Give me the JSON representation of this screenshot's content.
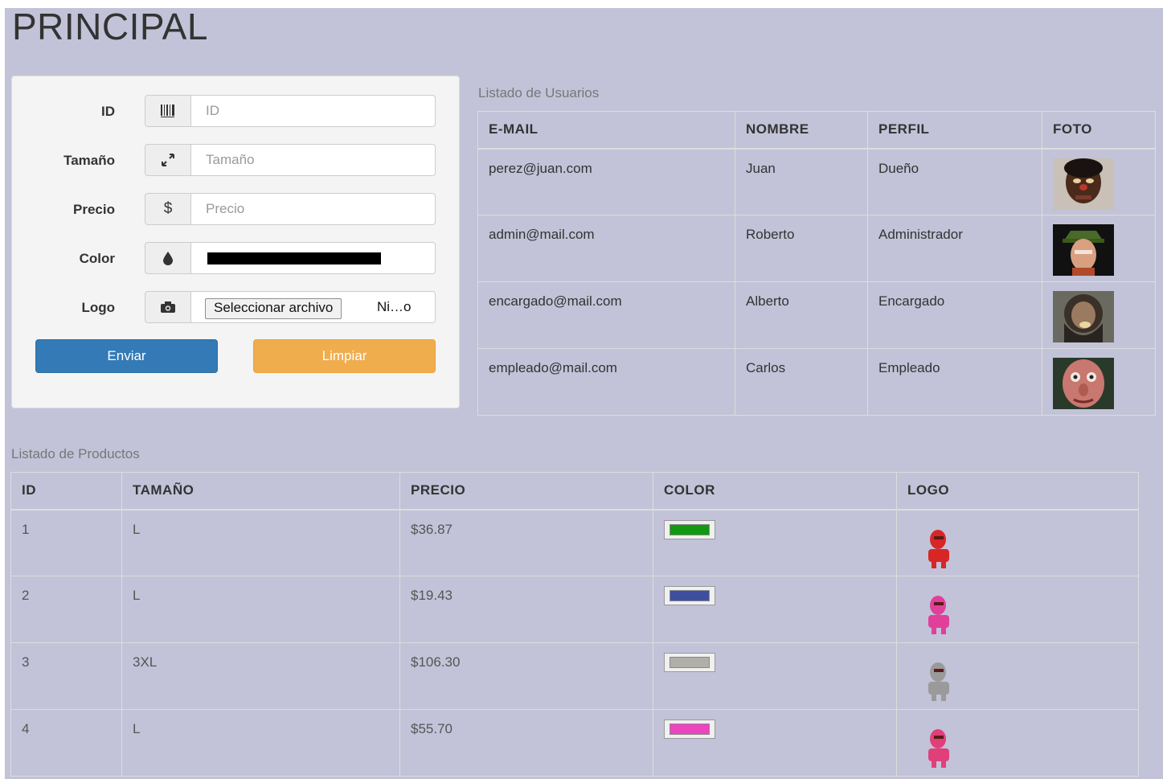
{
  "page_title": "PRINCIPAL",
  "form": {
    "fields": [
      {
        "label": "ID",
        "placeholder": "ID",
        "icon": "barcode-icon"
      },
      {
        "label": "Tamaño",
        "placeholder": "Tamaño",
        "icon": "resize-icon"
      },
      {
        "label": "Precio",
        "placeholder": "Precio",
        "icon": "dollar-icon"
      },
      {
        "label": "Color",
        "value": "#000000",
        "icon": "tint-icon"
      },
      {
        "label": "Logo",
        "file_button": "Seleccionar archivo",
        "file_name": "Ni…o",
        "icon": "camera-icon"
      }
    ],
    "submit_label": "Enviar",
    "clear_label": "Limpiar"
  },
  "users": {
    "caption": "Listado de Usuarios",
    "headers": [
      "E-MAIL",
      "NOMBRE",
      "PERFIL",
      "FOTO"
    ],
    "rows": [
      {
        "email": "perez@juan.com",
        "nombre": "Juan",
        "perfil": "Dueño"
      },
      {
        "email": "admin@mail.com",
        "nombre": "Roberto",
        "perfil": "Administrador"
      },
      {
        "email": "encargado@mail.com",
        "nombre": "Alberto",
        "perfil": "Encargado"
      },
      {
        "email": "empleado@mail.com",
        "nombre": "Carlos",
        "perfil": "Empleado"
      }
    ]
  },
  "products": {
    "caption": "Listado de Productos",
    "headers": [
      "ID",
      "TAMAÑO",
      "PRECIO",
      "COLOR",
      "LOGO"
    ],
    "rows": [
      {
        "id": "1",
        "tamano": "L",
        "precio": "$36.87",
        "color": "#119911",
        "logo_color": "#d82626"
      },
      {
        "id": "2",
        "tamano": "L",
        "precio": "$19.43",
        "color": "#3f4fa0",
        "logo_color": "#e0409a"
      },
      {
        "id": "3",
        "tamano": "3XL",
        "precio": "$106.30",
        "color": "#b0b0a8",
        "logo_color": "#9a9a9a"
      },
      {
        "id": "4",
        "tamano": "L",
        "precio": "$55.70",
        "color": "#ee44c0",
        "logo_color": "#e0407a"
      }
    ]
  },
  "colors": {
    "background": "#c2c3d8",
    "primary": "#337ab7",
    "warning": "#f0ad4e"
  }
}
